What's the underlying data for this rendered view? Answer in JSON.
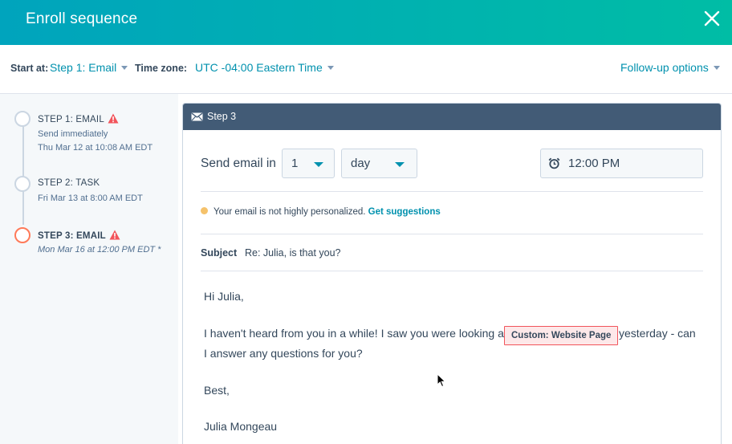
{
  "header": {
    "title": "Enroll sequence"
  },
  "topbar": {
    "start_at_label": "Start at:",
    "start_at_value": "Step 1: Email",
    "timezone_label": "Time zone:",
    "timezone_value": "UTC -04:00 Eastern Time",
    "followup_label": "Follow-up options"
  },
  "steps": [
    {
      "title": "STEP 1: EMAIL",
      "warning": true,
      "line1": "Send immediately",
      "line2": "Thu Mar 12 at 10:08 AM EDT"
    },
    {
      "title": "STEP 2: TASK",
      "warning": false,
      "line1": "Fri Mar 13 at 8:00 AM EDT"
    },
    {
      "title": "STEP 3: EMAIL",
      "warning": true,
      "line1": "Mon Mar 16 at 12:00 PM EDT *",
      "active": true
    }
  ],
  "panel": {
    "title": "Step 3",
    "send_label": "Send email in",
    "delay_value": "1",
    "delay_unit": "day",
    "time_value": "12:00 PM",
    "personalization_text": "Your email is not highly personalized.",
    "suggestions_link": "Get suggestions",
    "subject_label": "Subject",
    "subject_value": "Re: Julia, is that you?",
    "body": {
      "greeting": "Hi Julia,",
      "line1_before": "I haven't heard from you in a while! I saw you were looking at",
      "token": "Custom: Website Page",
      "line1_after": "yesterday - can",
      "line2": "I answer any questions for you?",
      "signoff": "Best,",
      "signature": "Julia Mongeau"
    }
  },
  "colors": {
    "header_start": "#00a4bd",
    "header_end": "#00bda5",
    "link": "#0091ae",
    "active_step": "#ff7a59",
    "warning": "#f2545b",
    "panel_header": "#425b76"
  }
}
